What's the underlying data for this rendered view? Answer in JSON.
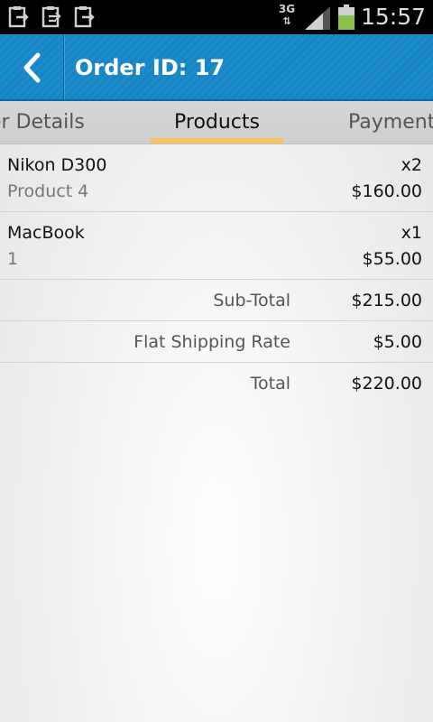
{
  "status_bar": {
    "network": "3G",
    "time": "15:57",
    "battery_color": "#8bc34a",
    "notification_icons": [
      "clipboard-export-icon",
      "clipboard-sync-icon",
      "clipboard-export-icon"
    ]
  },
  "action_bar": {
    "title": "Order ID: 17",
    "background_color": "#1b8bc9"
  },
  "tabs": {
    "items": [
      {
        "label": "er Details"
      },
      {
        "label": "Products",
        "selected": true
      },
      {
        "label": "Payment"
      }
    ],
    "indicator_color": "#f5c362"
  },
  "products": [
    {
      "name": "Nikon D300",
      "subtitle": "Product 4",
      "quantity": "x2",
      "price": "$160.00"
    },
    {
      "name": "MacBook",
      "subtitle": "1",
      "quantity": "x1",
      "price": "$55.00"
    }
  ],
  "totals": [
    {
      "label": "Sub-Total",
      "value": "$215.00"
    },
    {
      "label": "Flat Shipping Rate",
      "value": "$5.00"
    },
    {
      "label": "Total",
      "value": "$220.00"
    }
  ]
}
